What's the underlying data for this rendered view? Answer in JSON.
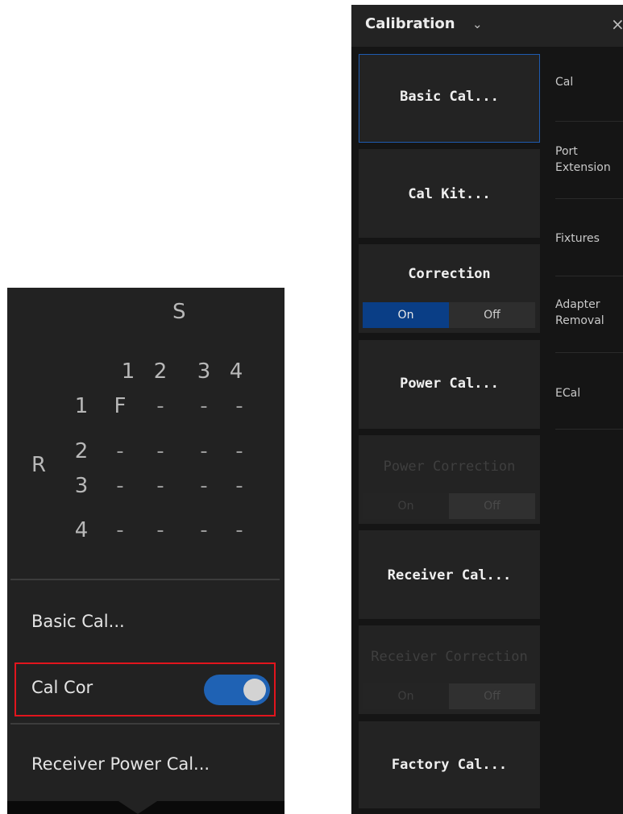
{
  "matrix": {
    "s_label": "S",
    "r_label": "R",
    "col_headers": [
      "1",
      "2",
      "3",
      "4"
    ],
    "rows": [
      {
        "header": "1",
        "cells": [
          "F",
          "-",
          "-",
          "-"
        ]
      },
      {
        "header": "2",
        "cells": [
          "-",
          "-",
          "-",
          "-"
        ]
      },
      {
        "header": "3",
        "cells": [
          "-",
          "-",
          "-",
          "-"
        ]
      },
      {
        "header": "4",
        "cells": [
          "-",
          "-",
          "-",
          "-"
        ]
      }
    ]
  },
  "left_menu": {
    "basic_cal": "Basic Cal...",
    "cal_cor": "Cal Cor",
    "cal_cor_on": true,
    "receiver_power_cal": "Receiver Power Cal..."
  },
  "right_panel": {
    "title": "Calibration",
    "title_chevron": "⌄",
    "close": "×",
    "buttons": {
      "basic_cal": "Basic Cal...",
      "cal_kit": "Cal Kit...",
      "correction": "Correction",
      "power_cal": "Power Cal...",
      "power_correction": "Power Correction",
      "receiver_cal": "Receiver Cal...",
      "receiver_correction": "Receiver Correction",
      "factory_cal": "Factory Cal..."
    },
    "segment": {
      "on": "On",
      "off": "Off"
    },
    "correction_state": "On",
    "side_menu": {
      "cal": "Cal",
      "port_extension_1": "Port",
      "port_extension_2": "Extension",
      "fixtures": "Fixtures",
      "adapter_removal_1": "Adapter",
      "adapter_removal_2": "Removal",
      "ecal": "ECal"
    }
  },
  "colors": {
    "accent": "#1f62b4",
    "active_segment": "#0a3e86",
    "highlight_box": "#e2151d"
  }
}
